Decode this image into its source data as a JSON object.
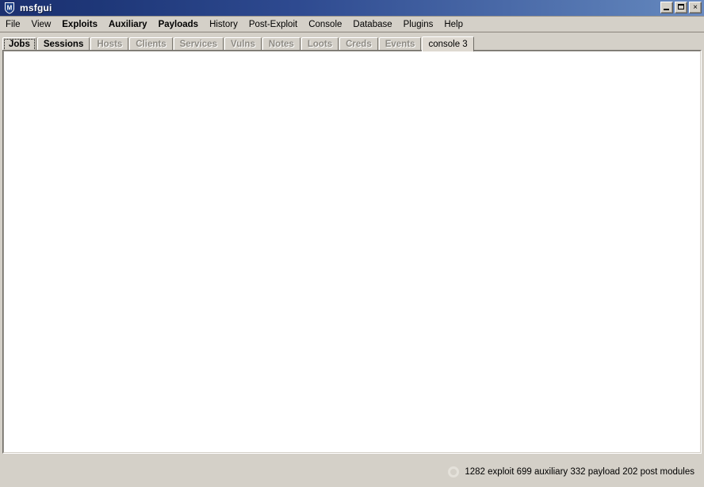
{
  "window": {
    "title": "msfgui",
    "icon": "msf-shield-icon",
    "controls": {
      "minimize_label": "_",
      "maximize_label": "□",
      "close_label": "×",
      "minimize_name": "minimize",
      "maximize_name": "maximize",
      "close_name": "close"
    },
    "colors": {
      "titlebar_start": "#1b3070",
      "titlebar_end": "#6a8ac0",
      "face": "#d4d0c8",
      "content": "#ffffff",
      "disabled_text": "#8e8b84"
    }
  },
  "menubar": {
    "items": [
      {
        "label": "File",
        "bold": false
      },
      {
        "label": "View",
        "bold": false
      },
      {
        "label": "Exploits",
        "bold": true
      },
      {
        "label": "Auxiliary",
        "bold": true
      },
      {
        "label": "Payloads",
        "bold": true
      },
      {
        "label": "History",
        "bold": false
      },
      {
        "label": "Post-Exploit",
        "bold": false
      },
      {
        "label": "Console",
        "bold": false
      },
      {
        "label": "Database",
        "bold": false
      },
      {
        "label": "Plugins",
        "bold": false
      },
      {
        "label": "Help",
        "bold": false
      }
    ]
  },
  "tabs": [
    {
      "label": "Jobs",
      "state": "focused"
    },
    {
      "label": "Sessions",
      "state": "enabled"
    },
    {
      "label": "Hosts",
      "state": "disabled"
    },
    {
      "label": "Clients",
      "state": "disabled"
    },
    {
      "label": "Services",
      "state": "disabled"
    },
    {
      "label": "Vulns",
      "state": "disabled"
    },
    {
      "label": "Notes",
      "state": "disabled"
    },
    {
      "label": "Loots",
      "state": "disabled"
    },
    {
      "label": "Creds",
      "state": "disabled"
    },
    {
      "label": "Events",
      "state": "disabled"
    },
    {
      "label": "console 3",
      "state": "active"
    }
  ],
  "console": {
    "output": ""
  },
  "statusbar": {
    "spinner_icon": "loading-ring-icon",
    "text": "1282 exploit 699 auxiliary 332 payload 202 post modules",
    "counts": {
      "exploit": 1282,
      "auxiliary": 699,
      "payload": 332,
      "post": 202
    }
  }
}
